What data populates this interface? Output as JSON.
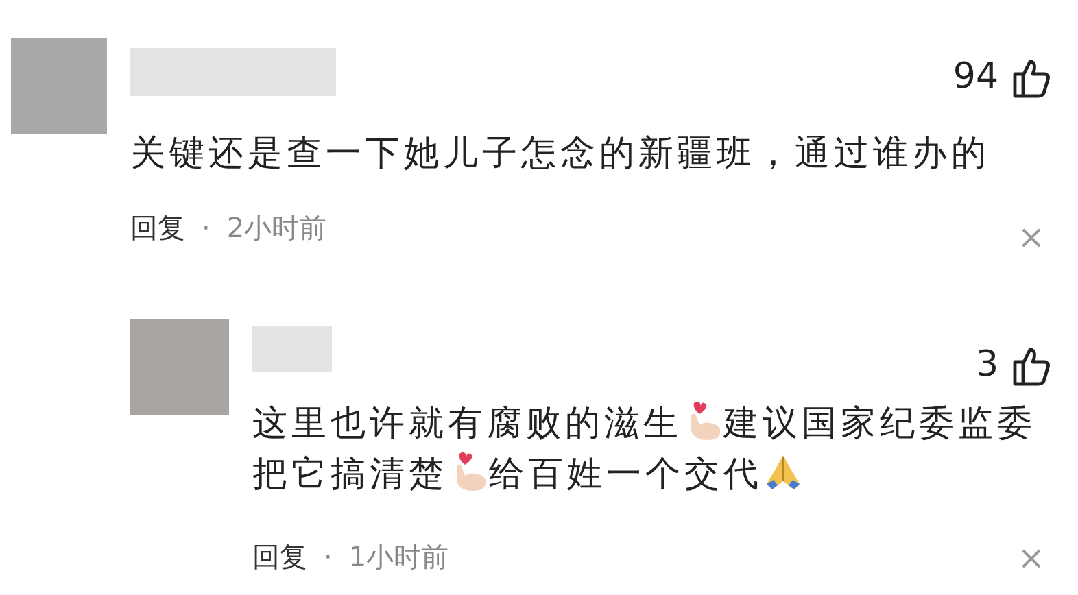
{
  "comments": [
    {
      "likes": "94",
      "lines": [
        [
          {
            "kind": "text",
            "text": "关键还是查一下她儿子怎念的新疆班，通过谁办的"
          }
        ]
      ],
      "reply": "回复",
      "dot": "·",
      "time": "2小时前",
      "close": "×",
      "children": [
        {
          "likes": "3",
          "lines": [
            [
              {
                "kind": "text",
                "text": "这里也许就有腐败的滋生"
              },
              {
                "kind": "finger-heart"
              },
              {
                "kind": "text",
                "text": "建议国家纪委监委"
              }
            ],
            [
              {
                "kind": "text",
                "text": "把它搞清楚"
              },
              {
                "kind": "finger-heart"
              },
              {
                "kind": "text",
                "text": "给百姓一个交代"
              },
              {
                "kind": "pray"
              }
            ]
          ],
          "reply": "回复",
          "dot": "·",
          "time": "1小时前",
          "close": "×"
        }
      ]
    }
  ]
}
